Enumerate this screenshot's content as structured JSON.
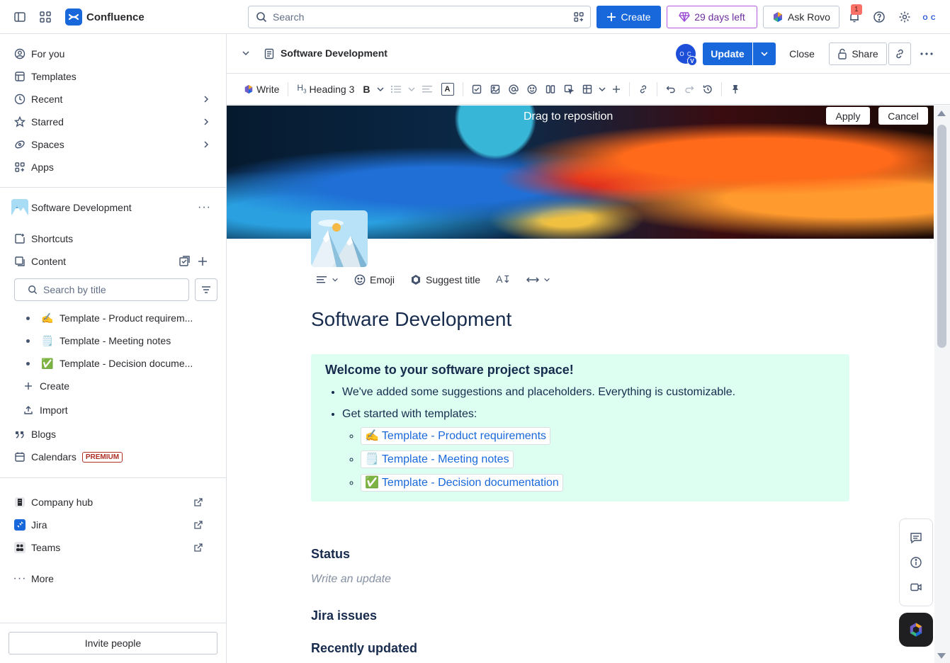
{
  "topnav": {
    "app_name": "Confluence",
    "search_placeholder": "Search",
    "create_label": "Create",
    "trial_label": "29 days left",
    "rovo_label": "Ask Rovo",
    "notification_count": "1",
    "avatar_text": "O C",
    "accent": "#1868db"
  },
  "sidebar": {
    "items": [
      {
        "label": "For you",
        "icon": "person-circle-icon"
      },
      {
        "label": "Templates",
        "icon": "template-icon"
      },
      {
        "label": "Recent",
        "icon": "clock-icon"
      },
      {
        "label": "Starred",
        "icon": "star-icon"
      },
      {
        "label": "Spaces",
        "icon": "spaces-icon"
      },
      {
        "label": "Apps",
        "icon": "apps-icon"
      }
    ],
    "space_name": "Software Development",
    "shortcuts_label": "Shortcuts",
    "content_label": "Content",
    "search_placeholder": "Search by title",
    "tree": [
      {
        "emoji": "✍️",
        "label": "Template - Product requirem..."
      },
      {
        "emoji": "🗒️",
        "label": "Template - Meeting notes"
      },
      {
        "emoji": "✅",
        "label": "Template - Decision docume..."
      }
    ],
    "create_label": "Create",
    "import_label": "Import",
    "blogs_label": "Blogs",
    "calendars_label": "Calendars",
    "premium_badge": "PREMIUM",
    "links": [
      {
        "label": "Company hub"
      },
      {
        "label": "Jira"
      },
      {
        "label": "Teams"
      }
    ],
    "more_label": "More",
    "invite_label": "Invite people"
  },
  "page_header": {
    "title": "Software Development",
    "avatar_text": "O C",
    "avatar_badge": "V",
    "update_label": "Update",
    "close_label": "Close",
    "share_label": "Share"
  },
  "toolbar": {
    "write_label": "Write",
    "heading_label": "Heading 3"
  },
  "cover": {
    "drag_label": "Drag to reposition",
    "apply_label": "Apply",
    "cancel_label": "Cancel"
  },
  "title_toolbar": {
    "emoji_label": "Emoji",
    "suggest_label": "Suggest title"
  },
  "page": {
    "title": "Software Development",
    "panel_title": "Welcome to your software project space!",
    "bullet_1": "We've added some suggestions and placeholders. Everything is customizable.",
    "bullet_2": "Get started with templates:",
    "templates": [
      {
        "emoji": "✍️",
        "label": "Template - Product requirements"
      },
      {
        "emoji": "🗒️",
        "label": "Template - Meeting notes"
      },
      {
        "emoji": "✅",
        "label": "Template - Decision documentation"
      }
    ],
    "status_heading": "Status",
    "status_placeholder": "Write an update",
    "jira_heading": "Jira issues",
    "recent_heading": "Recently updated",
    "panel_color": "#dcfff1"
  }
}
